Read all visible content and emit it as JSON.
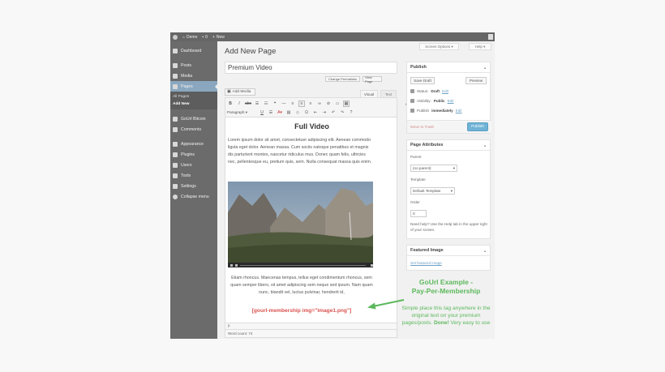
{
  "admin_bar": {
    "site_name": "Demo",
    "new_label": "New",
    "comments_count": "0"
  },
  "sidebar": {
    "items": [
      {
        "label": "Dashboard",
        "icon": "dashboard-icon"
      },
      {
        "label": "Posts",
        "icon": "pin-icon"
      },
      {
        "label": "Media",
        "icon": "media-icon"
      },
      {
        "label": "Pages",
        "icon": "pages-icon",
        "active": true
      },
      {
        "label": "GoUrl Bitcoin",
        "icon": "bitcoin-icon"
      },
      {
        "label": "Comments",
        "icon": "comments-icon"
      },
      {
        "label": "Appearance",
        "icon": "brush-icon"
      },
      {
        "label": "Plugins",
        "icon": "plugin-icon"
      },
      {
        "label": "Users",
        "icon": "users-icon"
      },
      {
        "label": "Tools",
        "icon": "tools-icon"
      },
      {
        "label": "Settings",
        "icon": "settings-icon"
      },
      {
        "label": "Collapse menu",
        "icon": "collapse-icon"
      }
    ],
    "submenu": [
      "All Pages",
      "Add New"
    ]
  },
  "header": {
    "screen_options": "Screen Options ▾",
    "help": "Help ▾",
    "title": "Add New Page"
  },
  "post": {
    "title": "Premium Video",
    "change_permalinks": "Change Permalinks",
    "view_page": "View Page"
  },
  "editor": {
    "add_media": "Add Media",
    "tab_visual": "Visual",
    "tab_text": "Text",
    "format": "Paragraph",
    "heading": "Full Video",
    "para1": "Lorem ipsum dolor sit amet, consectetuer adipiscing elit. Aenean commodo ligula eget dolor. Aenean massa. Cum sociis natoque penatibus et magnis dis parturient montes, nascetur ridiculus mus. Donec quam felis, ultricies nec, pellentesque eu, pretium quis, sem. Nulla consequat massa quis enim.",
    "para2": "Etiam rhoncus. Maecenas tempus, tellus eget condimentum rhoncus, sem quam semper libero, sit amet adipiscing sem neque sed ipsum. Nam quam nunc, blandit vel, luctus pulvinar, hendrerit id,",
    "shortcode": "[gourl-membership img=\"image1.png\"]",
    "path": "p",
    "word_count": "Word count: 74"
  },
  "publish": {
    "title": "Publish",
    "save_draft": "Save Draft",
    "preview": "Preview",
    "status_label": "Status:",
    "status_value": "Draft",
    "visibility_label": "Visibility:",
    "visibility_value": "Public",
    "publish_label": "Publish",
    "publish_value": "immediately",
    "edit": "Edit",
    "trash": "Move to Trash",
    "publish_button": "Publish"
  },
  "page_attributes": {
    "title": "Page Attributes",
    "parent_label": "Parent",
    "parent_value": "(no parent)",
    "template_label": "Template",
    "template_value": "Default Template",
    "order_label": "Order",
    "order_value": "0",
    "help_text": "Need help? Use the Help tab in the upper right of your screen."
  },
  "featured_image": {
    "title": "Featured Image",
    "link": "Set featured image"
  },
  "callout": {
    "title_line1": "GoUrl Example -",
    "title_line2": "Pay-Per-Membership",
    "body_start": "Simple place this tag anywhere in the original text on your premium pages/posts. ",
    "body_done": "Done!",
    "body_end": " Very easy to use"
  },
  "colors": {
    "accent": "#5cb85c",
    "shortcode": "#d9534f",
    "publish": "#6fb3d6"
  }
}
